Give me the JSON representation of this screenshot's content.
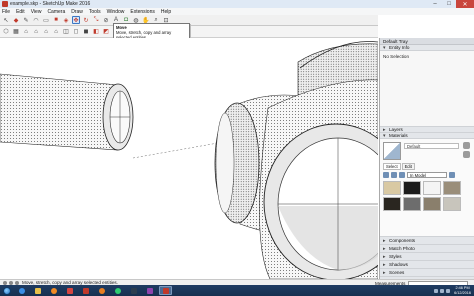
{
  "window": {
    "title": "example.skp - SketchUp Make 2016",
    "min": "–",
    "max": "□",
    "close": "✕"
  },
  "menu": [
    "File",
    "Edit",
    "View",
    "Camera",
    "Draw",
    "Tools",
    "Window",
    "Extensions",
    "Help"
  ],
  "toolbar": {
    "icons": [
      "select-icon",
      "eraser-icon",
      "pencil-icon",
      "arc-icon",
      "rectangle-icon",
      "push-pull-icon",
      "offset-icon",
      "move-icon",
      "rotate-icon",
      "scale-icon",
      "tape-icon",
      "text-icon",
      "paint-icon",
      "orbit-icon",
      "pan-icon",
      "zoom-icon",
      "zoom-extents-icon"
    ]
  },
  "tooltip": {
    "title": "Move",
    "description": "Move, stretch, copy and array selected entities."
  },
  "tray": {
    "title": "Default Tray",
    "entity_info": {
      "label": "Entity Info",
      "value": "No Selection"
    },
    "layers": "Layers",
    "materials": {
      "label": "Materials",
      "name": "Default",
      "tab_select": "Select",
      "tab_edit": "Edit",
      "collection": "In Model",
      "swatches": [
        "#d9c9a3",
        "#1c1c1c",
        "#f4f4f4",
        "#9a8e7a",
        "#2a2620",
        "#6d6d6d",
        "#8a7f6c",
        "#c8c5bc"
      ]
    },
    "sections": [
      "Components",
      "Match Photo",
      "Styles",
      "Shadows",
      "Scenes",
      "Instructor",
      "Soften Edges"
    ]
  },
  "status": {
    "text": "Move, stretch, copy and array selected entities.",
    "measurements_label": "Measurements"
  },
  "taskbar": {
    "time": "2:46 PM",
    "date": "6/12/2016"
  }
}
